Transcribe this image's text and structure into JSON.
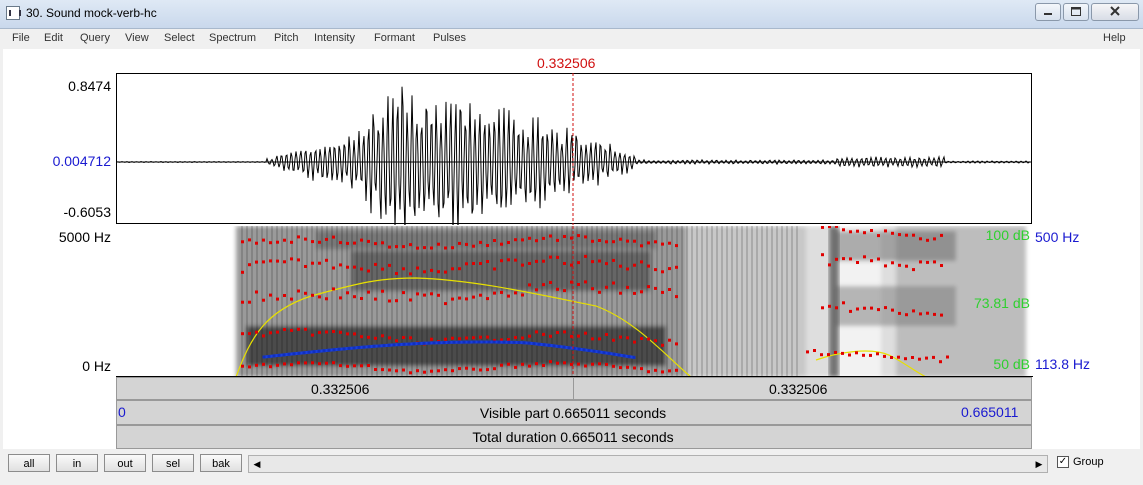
{
  "window": {
    "title": "30. Sound mock-verb-hc"
  },
  "menu": [
    "File",
    "Edit",
    "Query",
    "View",
    "Select",
    "Spectrum",
    "Pitch",
    "Intensity",
    "Formant",
    "Pulses"
  ],
  "help_label": "Help",
  "cursor_time": "0.332506",
  "waveform": {
    "y_max": "0.8474",
    "y_cursor": "0.004712",
    "y_min": "-0.6053"
  },
  "spectrogram": {
    "freq_max": "5000 Hz",
    "freq_min": "0 Hz",
    "intensity_max": "100 dB",
    "intensity_mid": "73.81 dB",
    "intensity_min": "50 dB",
    "pitch_max": "500 Hz",
    "pitch_cursor": "113.8 Hz"
  },
  "time_bar": {
    "left_part": "0.332506",
    "right_part": "0.332506"
  },
  "visible_bar": {
    "start": "0",
    "label": "Visible part 0.665011 seconds",
    "end": "0.665011"
  },
  "total_bar": {
    "label": "Total duration 0.665011 seconds"
  },
  "buttons": {
    "all": "all",
    "in": "in",
    "out": "out",
    "sel": "sel",
    "bak": "bak"
  },
  "group": {
    "label": "Group",
    "checked": true,
    "checkmark": "✓"
  },
  "colors": {
    "cursor": "#d01010",
    "pitch": "#1a40e0",
    "formant": "#e00000",
    "intensity": "#e8e000",
    "dB": "#2fd02f"
  }
}
